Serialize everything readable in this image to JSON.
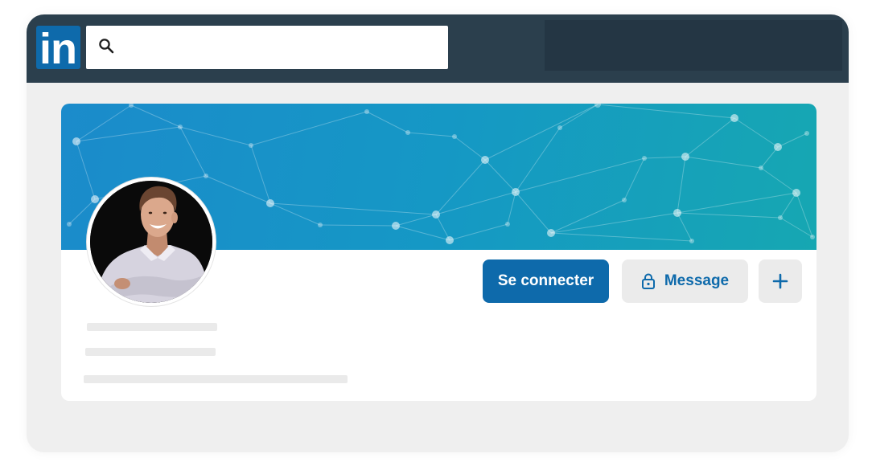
{
  "header": {
    "logo_text": "in",
    "logo_icon": "linkedin-logo",
    "search_icon": "search-icon"
  },
  "profile": {
    "actions": {
      "connect_label": "Se connecter",
      "message_label": "Message",
      "message_icon": "lock-icon",
      "more_icon": "plus-icon"
    }
  },
  "colors": {
    "page_bg": "#efefef",
    "topbar": "#2b3f4d",
    "topbar_block": "#243644",
    "brand_blue": "#0e6aab",
    "secondary_button": "#ebebeb",
    "banner_start": "#1b8bcb",
    "banner_end": "#16a7b2",
    "skeleton": "#eaeaea"
  }
}
